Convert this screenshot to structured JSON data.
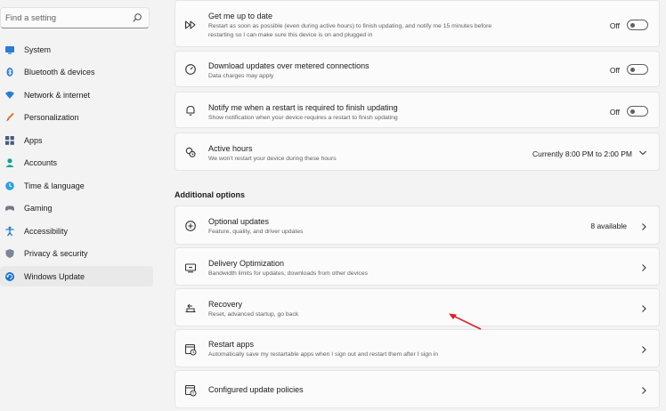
{
  "search": {
    "placeholder": "Find a setting"
  },
  "sidebar": {
    "items": [
      {
        "label": "System",
        "icon": "monitor-icon",
        "active": false
      },
      {
        "label": "Bluetooth & devices",
        "icon": "bluetooth-icon",
        "active": false
      },
      {
        "label": "Network & internet",
        "icon": "wifi-icon",
        "active": false
      },
      {
        "label": "Personalization",
        "icon": "brush-icon",
        "active": false
      },
      {
        "label": "Apps",
        "icon": "apps-icon",
        "active": false
      },
      {
        "label": "Accounts",
        "icon": "person-icon",
        "active": false
      },
      {
        "label": "Time & language",
        "icon": "globe-clock-icon",
        "active": false
      },
      {
        "label": "Gaming",
        "icon": "gamepad-icon",
        "active": false
      },
      {
        "label": "Accessibility",
        "icon": "accessibility-icon",
        "active": false
      },
      {
        "label": "Privacy & security",
        "icon": "shield-icon",
        "active": false
      },
      {
        "label": "Windows Update",
        "icon": "update-icon",
        "active": true
      }
    ]
  },
  "cards": {
    "get_up_to_date": {
      "title": "Get me up to date",
      "sub1": "Restart as soon as possible (even during active hours) to finish updating, and notify me 15 minutes before",
      "sub2": "restarting so I can make sure this device is on and plugged in",
      "toggle_label": "Off",
      "toggle_on": false
    },
    "metered": {
      "title": "Download updates over metered connections",
      "sub": "Data charges may apply",
      "toggle_label": "Off",
      "toggle_on": false
    },
    "notify_restart": {
      "title": "Notify me when a restart is required to finish updating",
      "sub": "Show notification when your device requires a restart to finish updating",
      "toggle_label": "Off",
      "toggle_on": false
    },
    "active_hours": {
      "title": "Active hours",
      "sub": "We won't restart your device during these hours",
      "value": "Currently 8:00 PM to 2:00 PM"
    }
  },
  "additional": {
    "heading": "Additional options",
    "optional_updates": {
      "title": "Optional updates",
      "sub": "Feature, quality, and driver updates",
      "value": "8 available"
    },
    "delivery": {
      "title": "Delivery Optimization",
      "sub": "Bandwidth limits for updates, downloads from other devices"
    },
    "recovery": {
      "title": "Recovery",
      "sub": "Reset, advanced startup, go back"
    },
    "restart_apps": {
      "title": "Restart apps",
      "sub": "Automatically save my restartable apps when I sign out and restart them after I sign in"
    },
    "policies": {
      "title": "Configured update policies"
    }
  },
  "colors": {
    "accent": "#0067c0",
    "annotation_arrow": "#d9202a"
  }
}
